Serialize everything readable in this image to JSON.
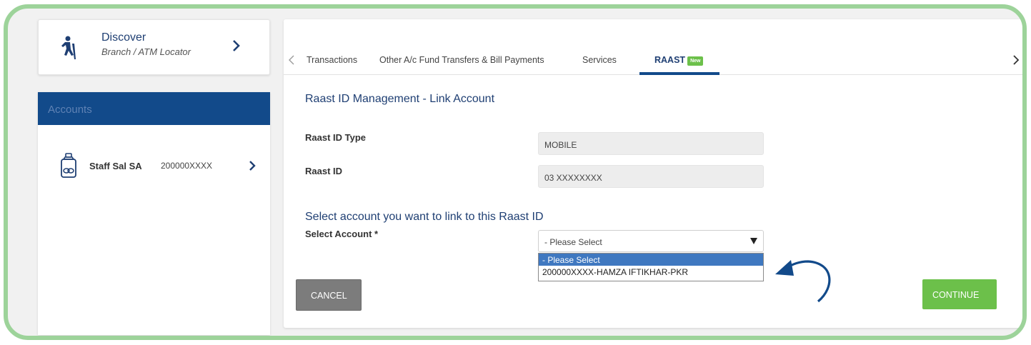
{
  "discover": {
    "title": "Discover",
    "subtitle": "Branch / ATM Locator",
    "icon": "hiker-icon"
  },
  "accounts": {
    "header": "Accounts",
    "items": [
      {
        "name": "Staff Sal SA",
        "number": "200000XXXX",
        "icon": "jar-icon"
      }
    ]
  },
  "tabs": {
    "items": [
      {
        "label": "Transactions"
      },
      {
        "label": "Other A/c Fund Transfers & Bill Payments"
      },
      {
        "label": "Services"
      },
      {
        "label": "RAAST",
        "badge": "New",
        "active": true
      }
    ]
  },
  "form": {
    "title": "Raast ID Management - Link Account",
    "raast_id_type_label": "Raast ID Type",
    "raast_id_type_value": "MOBILE",
    "raast_id_label": "Raast ID",
    "raast_id_value": "03 XXXXXXXX",
    "link_prompt": "Select account you want to link to this Raast ID",
    "select_account_label": "Select Account *",
    "select_account_value": "- Please Select",
    "options": [
      "- Please Select",
      "200000XXXX-HAMZA IFTIKHAR-PKR"
    ]
  },
  "buttons": {
    "cancel": "CANCEL",
    "continue": "CONTINUE"
  },
  "colors": {
    "frame_border": "#9dd39a",
    "primary_blue": "#124a8a",
    "accent_green": "#6cc04a",
    "cancel_gray": "#7c7c7c",
    "selected_option": "#3f78c0"
  }
}
